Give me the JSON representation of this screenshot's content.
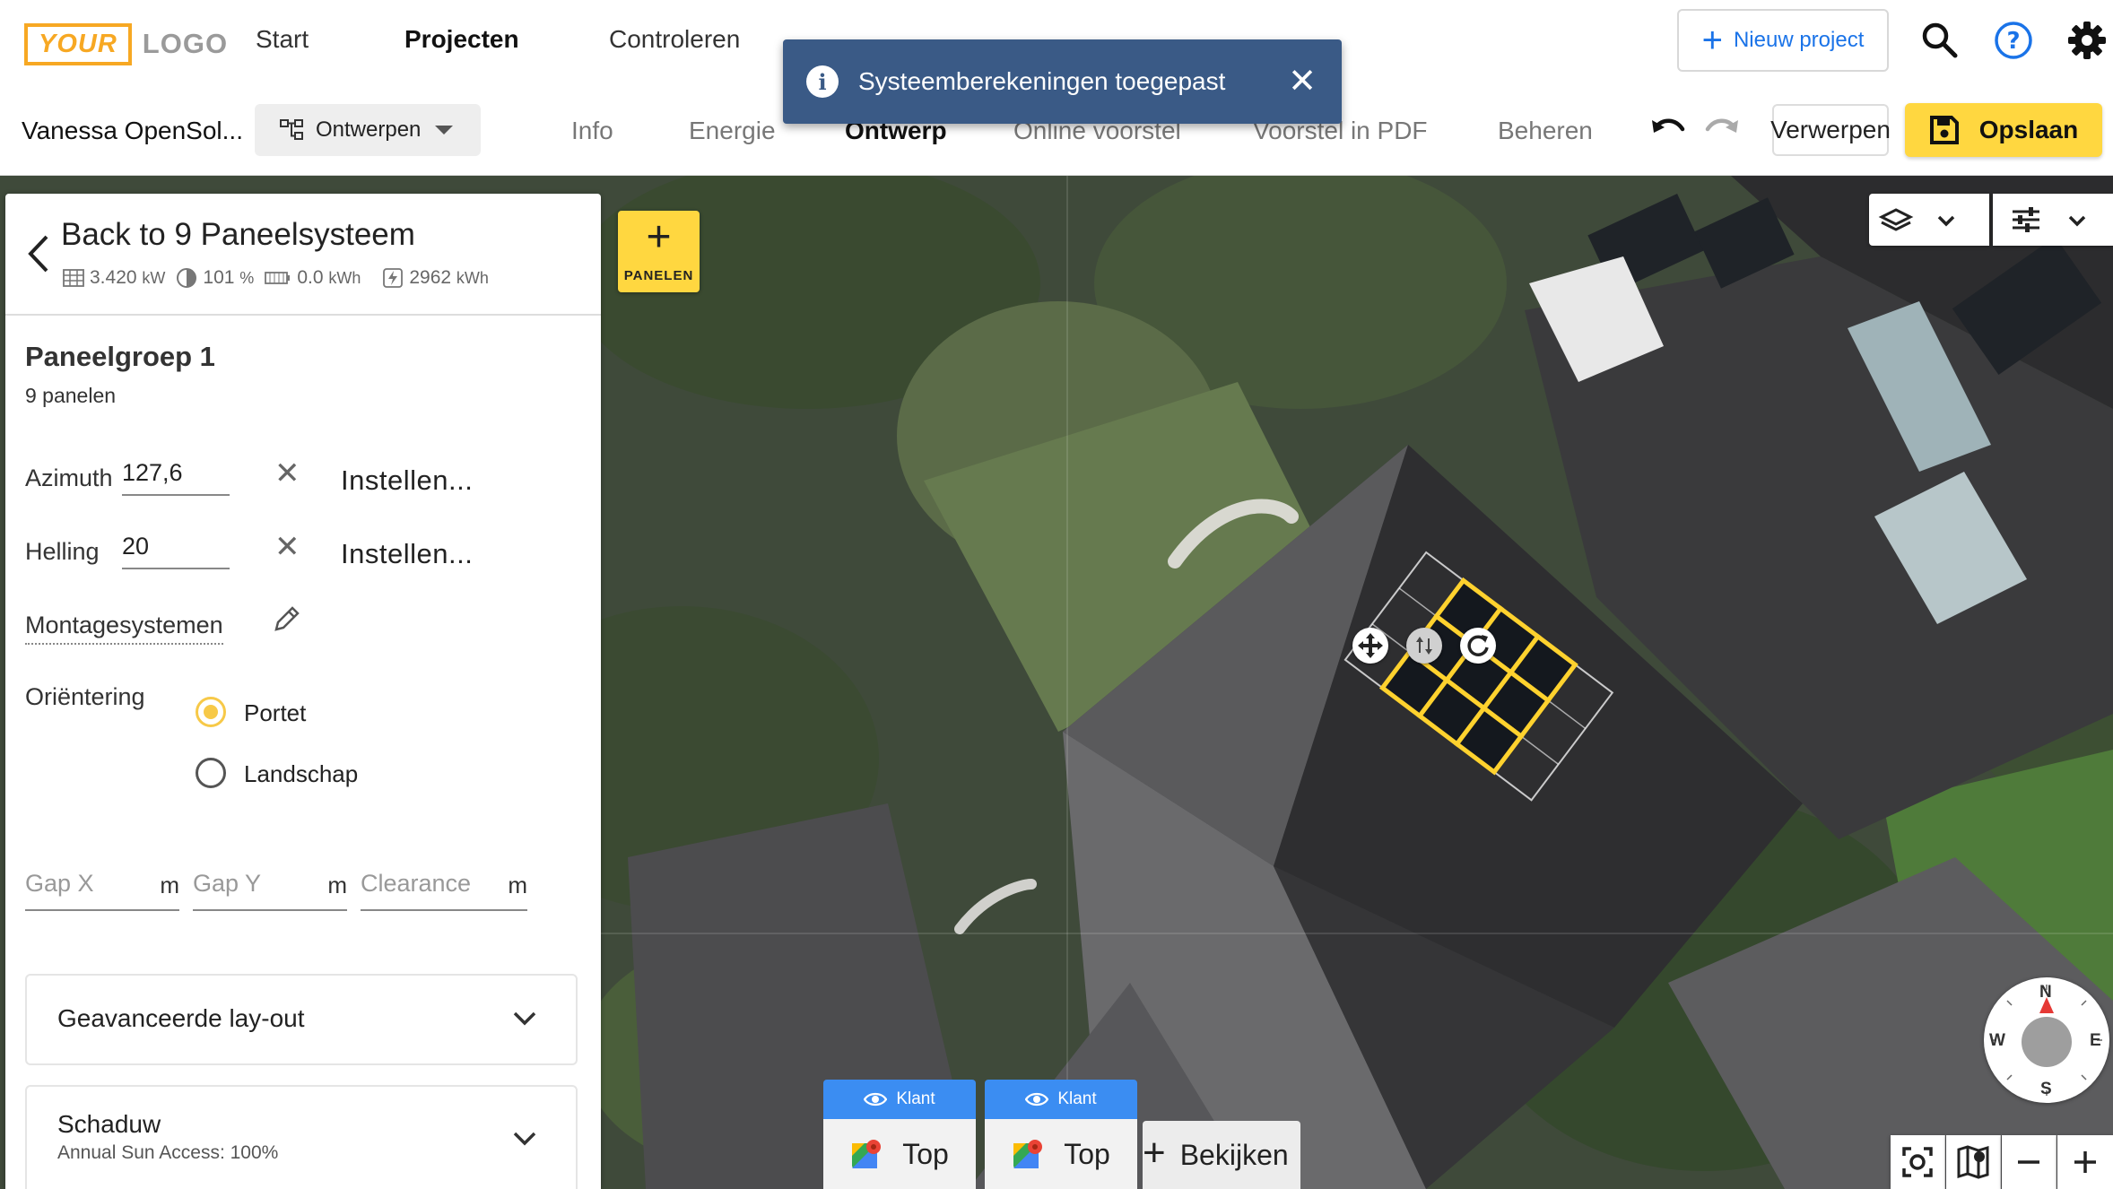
{
  "topnav": {
    "logo_your": "YOUR",
    "logo_logo": "LOGO",
    "links": [
      {
        "label": "Start",
        "active": false
      },
      {
        "label": "Projecten",
        "active": true
      },
      {
        "label": "Controleren",
        "active": false
      }
    ],
    "new_project_label": "Nieuw project",
    "icons": [
      "search-icon",
      "help-icon",
      "gear-icon"
    ]
  },
  "toast": {
    "message": "Systeemberekeningen toegepast",
    "close": "✕"
  },
  "subbar": {
    "project_name": "Vanessa OpenSol...",
    "design_selector": "Ontwerpen",
    "tabs": [
      {
        "label": "Info",
        "active": false
      },
      {
        "label": "Energie",
        "active": false
      },
      {
        "label": "Ontwerp",
        "active": true
      },
      {
        "label": "Online voorstel",
        "active": false
      },
      {
        "label": "Voorstel in PDF",
        "active": false
      },
      {
        "label": "Beheren",
        "active": false
      }
    ],
    "discard_label": "Verwerpen",
    "save_label": "Opslaan"
  },
  "panel": {
    "back_title": "Back to 9 Paneelsysteem",
    "stats": {
      "power_value": "3.420",
      "power_unit": "kW",
      "offset_value": "101",
      "offset_unit": "%",
      "battery_value": "0.0",
      "battery_unit": "kWh",
      "energy_value": "2962",
      "energy_unit": "kWh"
    },
    "group_title": "Paneelgroep 1",
    "group_sub": "9 panelen",
    "azimuth_label": "Azimuth",
    "azimuth_value": "127,6",
    "tilt_label": "Helling",
    "tilt_value": "20",
    "set_label": "Instellen...",
    "mounting_label": "Montagesystemen",
    "orientation_label": "Oriëntering",
    "orientation_options": [
      {
        "label": "Portet",
        "selected": true
      },
      {
        "label": "Landschap",
        "selected": false
      }
    ],
    "gap_x_placeholder": "Gap X",
    "gap_y_placeholder": "Gap Y",
    "clearance_placeholder": "Clearance",
    "unit_m": "m",
    "advanced_layout": "Geavanceerde lay-out",
    "shade_title": "Schaduw",
    "shade_sub": "Annual Sun Access: 100%"
  },
  "map": {
    "add_panels_label": "PANELEN",
    "compass": {
      "n": "N",
      "e": "E",
      "s": "S",
      "w": "W"
    },
    "view_buttons": [
      {
        "header": "Klant",
        "label": "Top"
      },
      {
        "header": "Klant",
        "label": "Top"
      }
    ],
    "view_all_label": "Bekijken"
  },
  "colors": {
    "accent_yellow": "#ffd740",
    "brand_blue": "#1a73e8",
    "toast_bg": "#3a5a86",
    "view_header_blue": "#3b8df2"
  }
}
